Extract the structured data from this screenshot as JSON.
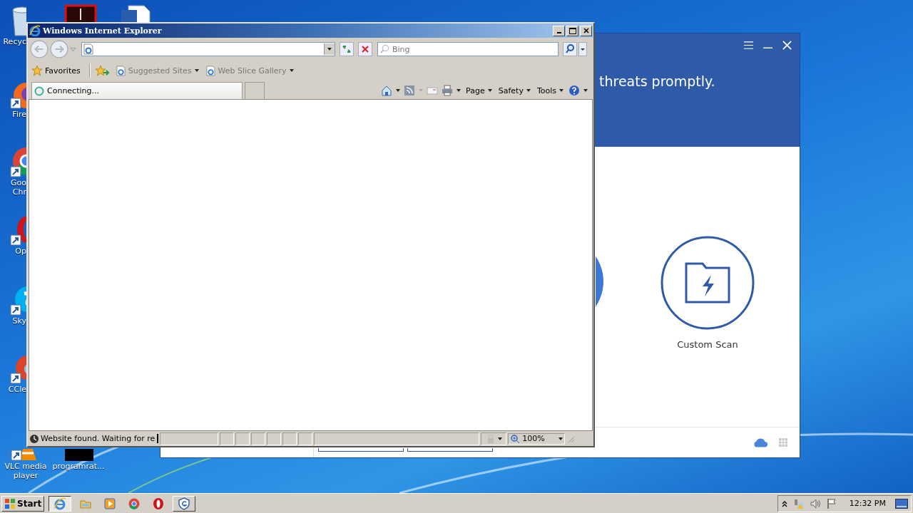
{
  "desktop": {
    "icons": [
      {
        "kind": "recycle-bin",
        "lines": [
          "Recyc"
        ]
      },
      {
        "kind": "app-tile"
      },
      {
        "kind": "word-document"
      },
      {
        "kind": "firefox",
        "lines": [
          "Fire"
        ]
      },
      {
        "kind": "chrome",
        "lines": [
          "Goo",
          "Chr"
        ]
      },
      {
        "kind": "opera",
        "lines": [
          "Op"
        ]
      },
      {
        "kind": "skype",
        "lines": [
          "Sky"
        ]
      },
      {
        "kind": "ccleaner",
        "lines": [
          "CCle"
        ]
      },
      {
        "kind": "vlc",
        "lines": [
          "VLC media",
          "player"
        ]
      },
      {
        "kind": "program",
        "lines": [
          "programrat..."
        ]
      }
    ]
  },
  "security_app": {
    "headline": "threats promptly.",
    "scan_option": {
      "label": "Custom Scan"
    }
  },
  "browser": {
    "title": "Windows Internet Explorer",
    "search": {
      "placeholder": "Bing"
    },
    "favorites_bar": {
      "label": "Favorites",
      "links": [
        {
          "label": "Suggested Sites"
        },
        {
          "label": "Web Slice Gallery"
        }
      ]
    },
    "tab": {
      "label": "Connecting..."
    },
    "commands": [
      "Page",
      "Safety",
      "Tools"
    ],
    "status_bar": {
      "text": "Website found. Waiting for re",
      "zoom": "100%"
    }
  },
  "taskbar": {
    "start": "Start",
    "apps": [
      {
        "kind": "internet-explorer",
        "open": true,
        "selected": true
      },
      {
        "kind": "folder",
        "open": false,
        "selected": false
      },
      {
        "kind": "media-player",
        "open": false,
        "selected": false
      },
      {
        "kind": "chrome",
        "open": false,
        "selected": false
      },
      {
        "kind": "opera",
        "open": false,
        "selected": false
      },
      {
        "kind": "shield",
        "open": true,
        "selected": false
      }
    ],
    "clock": "12:32 PM"
  }
}
